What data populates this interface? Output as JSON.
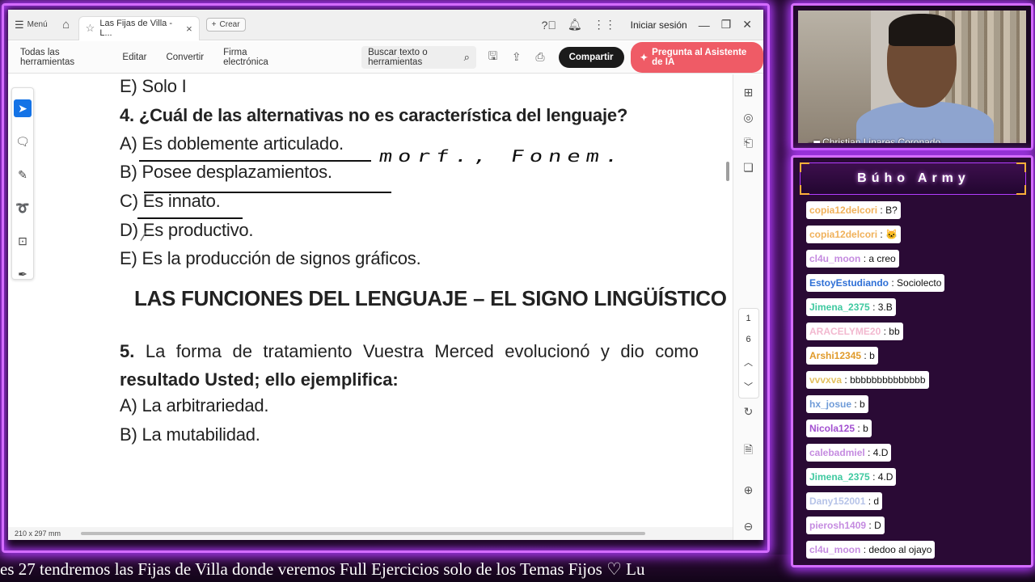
{
  "app": {
    "menu_label": "Menú",
    "tab_title": "Las Fijas de Villa - L...",
    "new_tab_label": "Crear",
    "signin_label": "Iniciar sesión"
  },
  "toolbar": {
    "items": [
      "Todas las herramientas",
      "Editar",
      "Convertir",
      "Firma electrónica"
    ],
    "search_placeholder": "Buscar texto o herramientas",
    "share_label": "Compartir",
    "ai_label": "Pregunta al Asistente de IA"
  },
  "document": {
    "line_e_prev": "E) Solo I",
    "q4_number": "4.",
    "q4_text": "¿Cuál de las alternativas no es característica del lenguaje?",
    "q4_options": [
      "A) Es doblemente articulado.",
      "B) Posee desplazamientos.",
      "C) Es innato.",
      "D) Es productivo.",
      "E) Es la producción de signos gráficos."
    ],
    "handwriting": "morf.,  Fonem.",
    "section_title": "LAS FUNCIONES DEL LENGUAJE – EL SIGNO LINGÜÍSTICO",
    "q5_number": "5.",
    "q5_text_a": " La forma de tratamiento Vuestra Merced evolucionó y dio como ",
    "q5_bold_a": "resultado Usted; ello ejemplifica:",
    "q5_options": [
      "A) La arbitrariedad.",
      "B) La mutabilidad."
    ]
  },
  "status": {
    "page_size": "210 x 297 mm"
  },
  "pager": {
    "current": "1",
    "total": "6"
  },
  "webcam": {
    "name": "Christian Linares Coronado"
  },
  "chat": {
    "title": "Búho Army",
    "messages": [
      {
        "user": "copia12delcori",
        "text": "B?",
        "color": "#f0b15a"
      },
      {
        "user": "copia12delcori",
        "text": "🐱",
        "color": "#f0b15a"
      },
      {
        "user": "cl4u_moon",
        "text": "a creo",
        "color": "#c58be0"
      },
      {
        "user": "EstoyEstudiando",
        "text": "Sociolecto",
        "color": "#2e6fd6"
      },
      {
        "user": "Jimena_2375",
        "text": "3.B",
        "color": "#3fc9a0"
      },
      {
        "user": "ARACELYME20",
        "text": "bb",
        "color": "#f2b8cf"
      },
      {
        "user": "Arshi12345",
        "text": "b",
        "color": "#e09a2a"
      },
      {
        "user": "vvvxva",
        "text": "bbbbbbbbbbbbbb",
        "color": "#e2c060"
      },
      {
        "user": "hx_josue",
        "text": "b",
        "color": "#6f9bd8"
      },
      {
        "user": "Nicola125",
        "text": "b",
        "color": "#a24fd0"
      },
      {
        "user": "calebadmiel",
        "text": "4.D",
        "color": "#c58be0"
      },
      {
        "user": "Jimena_2375",
        "text": "4.D",
        "color": "#3fc9a0"
      },
      {
        "user": "Dany152001",
        "text": "d",
        "color": "#b6c3e8"
      },
      {
        "user": "pierosh1409",
        "text": "D",
        "color": "#c58be0"
      },
      {
        "user": "cl4u_moon",
        "text": "dedoo al ojayo",
        "color": "#c58be0"
      }
    ]
  },
  "ticker": {
    "text": "es 27 tendremos las Fijas de Villa donde veremos Full Ejercicios solo de los Temas Fijos  ♡  Lu"
  },
  "colors": {
    "accent_purple": "#d46cff",
    "share_bg": "#1b1b1b",
    "ai_bg": "#ef5b66",
    "active_tool": "#1473e6"
  }
}
